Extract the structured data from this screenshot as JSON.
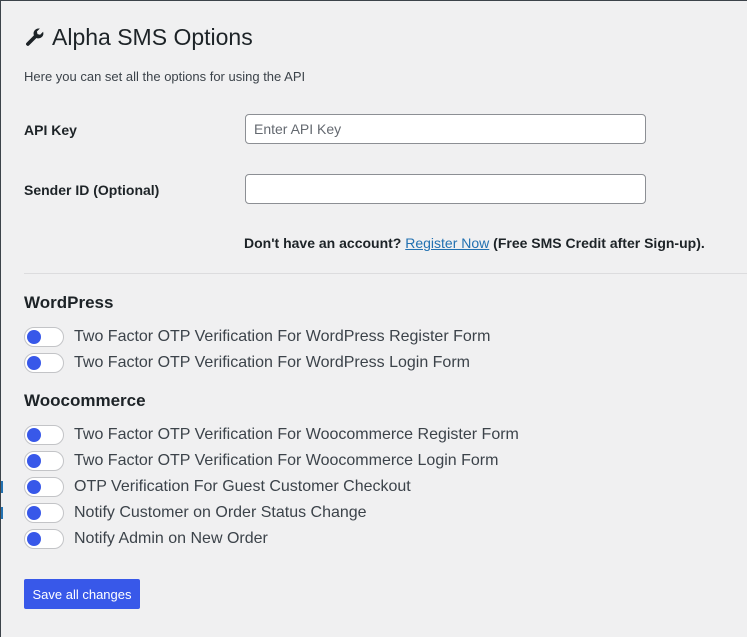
{
  "header": {
    "title": "Alpha SMS Options",
    "icon": "wrench-icon",
    "intro": "Here you can set all the options for using the API"
  },
  "fields": {
    "api_key": {
      "label": "API Key",
      "placeholder": "Enter API Key",
      "value": ""
    },
    "sender_id": {
      "label": "Sender ID (Optional)",
      "placeholder": "",
      "value": ""
    }
  },
  "account_note": {
    "prefix": "Don't have an account?",
    "link": "Register Now",
    "suffix": "(Free SMS Credit after Sign-up)."
  },
  "sections": [
    {
      "title": "WordPress",
      "toggles": [
        {
          "label": "Two Factor OTP Verification For WordPress Register Form",
          "on": false
        },
        {
          "label": "Two Factor OTP Verification For WordPress Login Form",
          "on": false
        }
      ]
    },
    {
      "title": "Woocommerce",
      "toggles": [
        {
          "label": "Two Factor OTP Verification For Woocommerce Register Form",
          "on": false
        },
        {
          "label": "Two Factor OTP Verification For Woocommerce Login Form",
          "on": false
        },
        {
          "label": "OTP Verification For Guest Customer Checkout",
          "on": false
        },
        {
          "label": "Notify Customer on Order Status Change",
          "on": false
        },
        {
          "label": "Notify Admin on New Order",
          "on": false
        }
      ]
    }
  ],
  "actions": {
    "save_label": "Save all changes"
  },
  "colors": {
    "accent": "#3858e9",
    "link": "#2271b1",
    "background": "#f0f0f1"
  }
}
